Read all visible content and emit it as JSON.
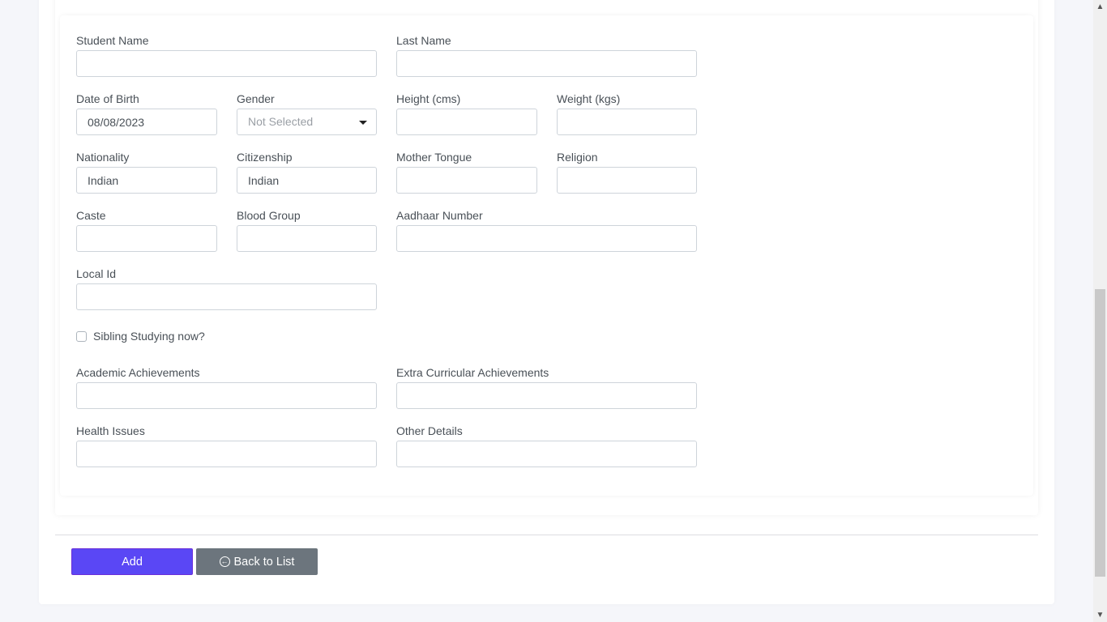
{
  "form": {
    "fields": {
      "student_name": {
        "label": "Student Name",
        "value": ""
      },
      "last_name": {
        "label": "Last Name",
        "value": ""
      },
      "dob": {
        "label": "Date of Birth",
        "value": "08/08/2023"
      },
      "gender": {
        "label": "Gender",
        "selected": "Not Selected"
      },
      "height": {
        "label": "Height (cms)",
        "value": ""
      },
      "weight": {
        "label": "Weight (kgs)",
        "value": ""
      },
      "nationality": {
        "label": "Nationality",
        "value": "Indian"
      },
      "citizenship": {
        "label": "Citizenship",
        "value": "Indian"
      },
      "mother_tongue": {
        "label": "Mother Tongue",
        "value": ""
      },
      "religion": {
        "label": "Religion",
        "value": ""
      },
      "caste": {
        "label": "Caste",
        "value": ""
      },
      "blood_group": {
        "label": "Blood Group",
        "value": ""
      },
      "aadhaar": {
        "label": "Aadhaar Number",
        "value": ""
      },
      "local_id": {
        "label": "Local Id",
        "value": ""
      },
      "academic": {
        "label": "Academic Achievements",
        "value": ""
      },
      "extra": {
        "label": "Extra Curricular Achievements",
        "value": ""
      },
      "health": {
        "label": "Health Issues",
        "value": ""
      },
      "other": {
        "label": "Other Details",
        "value": ""
      }
    },
    "sibling_checkbox": {
      "label": "Sibling Studying now?",
      "checked": false
    }
  },
  "actions": {
    "add_label": "Add",
    "back_label": "Back to List",
    "back_icon": "arrow-left-circle-icon"
  },
  "colors": {
    "primary": "#5a47f5",
    "secondary": "#6c757d"
  }
}
